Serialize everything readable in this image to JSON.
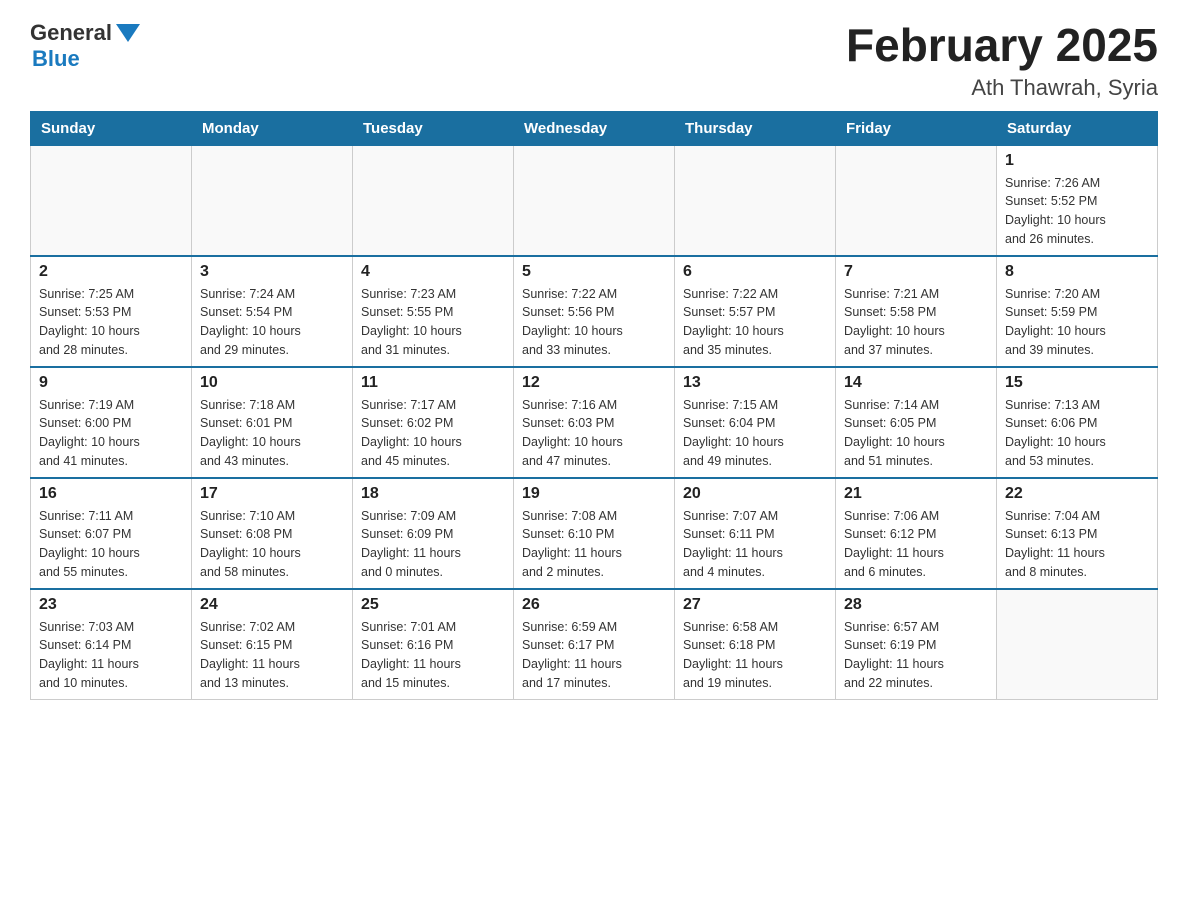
{
  "logo": {
    "general": "General",
    "blue": "Blue"
  },
  "title": "February 2025",
  "subtitle": "Ath Thawrah, Syria",
  "weekdays": [
    "Sunday",
    "Monday",
    "Tuesday",
    "Wednesday",
    "Thursday",
    "Friday",
    "Saturday"
  ],
  "weeks": [
    [
      {
        "day": "",
        "info": ""
      },
      {
        "day": "",
        "info": ""
      },
      {
        "day": "",
        "info": ""
      },
      {
        "day": "",
        "info": ""
      },
      {
        "day": "",
        "info": ""
      },
      {
        "day": "",
        "info": ""
      },
      {
        "day": "1",
        "info": "Sunrise: 7:26 AM\nSunset: 5:52 PM\nDaylight: 10 hours\nand 26 minutes."
      }
    ],
    [
      {
        "day": "2",
        "info": "Sunrise: 7:25 AM\nSunset: 5:53 PM\nDaylight: 10 hours\nand 28 minutes."
      },
      {
        "day": "3",
        "info": "Sunrise: 7:24 AM\nSunset: 5:54 PM\nDaylight: 10 hours\nand 29 minutes."
      },
      {
        "day": "4",
        "info": "Sunrise: 7:23 AM\nSunset: 5:55 PM\nDaylight: 10 hours\nand 31 minutes."
      },
      {
        "day": "5",
        "info": "Sunrise: 7:22 AM\nSunset: 5:56 PM\nDaylight: 10 hours\nand 33 minutes."
      },
      {
        "day": "6",
        "info": "Sunrise: 7:22 AM\nSunset: 5:57 PM\nDaylight: 10 hours\nand 35 minutes."
      },
      {
        "day": "7",
        "info": "Sunrise: 7:21 AM\nSunset: 5:58 PM\nDaylight: 10 hours\nand 37 minutes."
      },
      {
        "day": "8",
        "info": "Sunrise: 7:20 AM\nSunset: 5:59 PM\nDaylight: 10 hours\nand 39 minutes."
      }
    ],
    [
      {
        "day": "9",
        "info": "Sunrise: 7:19 AM\nSunset: 6:00 PM\nDaylight: 10 hours\nand 41 minutes."
      },
      {
        "day": "10",
        "info": "Sunrise: 7:18 AM\nSunset: 6:01 PM\nDaylight: 10 hours\nand 43 minutes."
      },
      {
        "day": "11",
        "info": "Sunrise: 7:17 AM\nSunset: 6:02 PM\nDaylight: 10 hours\nand 45 minutes."
      },
      {
        "day": "12",
        "info": "Sunrise: 7:16 AM\nSunset: 6:03 PM\nDaylight: 10 hours\nand 47 minutes."
      },
      {
        "day": "13",
        "info": "Sunrise: 7:15 AM\nSunset: 6:04 PM\nDaylight: 10 hours\nand 49 minutes."
      },
      {
        "day": "14",
        "info": "Sunrise: 7:14 AM\nSunset: 6:05 PM\nDaylight: 10 hours\nand 51 minutes."
      },
      {
        "day": "15",
        "info": "Sunrise: 7:13 AM\nSunset: 6:06 PM\nDaylight: 10 hours\nand 53 minutes."
      }
    ],
    [
      {
        "day": "16",
        "info": "Sunrise: 7:11 AM\nSunset: 6:07 PM\nDaylight: 10 hours\nand 55 minutes."
      },
      {
        "day": "17",
        "info": "Sunrise: 7:10 AM\nSunset: 6:08 PM\nDaylight: 10 hours\nand 58 minutes."
      },
      {
        "day": "18",
        "info": "Sunrise: 7:09 AM\nSunset: 6:09 PM\nDaylight: 11 hours\nand 0 minutes."
      },
      {
        "day": "19",
        "info": "Sunrise: 7:08 AM\nSunset: 6:10 PM\nDaylight: 11 hours\nand 2 minutes."
      },
      {
        "day": "20",
        "info": "Sunrise: 7:07 AM\nSunset: 6:11 PM\nDaylight: 11 hours\nand 4 minutes."
      },
      {
        "day": "21",
        "info": "Sunrise: 7:06 AM\nSunset: 6:12 PM\nDaylight: 11 hours\nand 6 minutes."
      },
      {
        "day": "22",
        "info": "Sunrise: 7:04 AM\nSunset: 6:13 PM\nDaylight: 11 hours\nand 8 minutes."
      }
    ],
    [
      {
        "day": "23",
        "info": "Sunrise: 7:03 AM\nSunset: 6:14 PM\nDaylight: 11 hours\nand 10 minutes."
      },
      {
        "day": "24",
        "info": "Sunrise: 7:02 AM\nSunset: 6:15 PM\nDaylight: 11 hours\nand 13 minutes."
      },
      {
        "day": "25",
        "info": "Sunrise: 7:01 AM\nSunset: 6:16 PM\nDaylight: 11 hours\nand 15 minutes."
      },
      {
        "day": "26",
        "info": "Sunrise: 6:59 AM\nSunset: 6:17 PM\nDaylight: 11 hours\nand 17 minutes."
      },
      {
        "day": "27",
        "info": "Sunrise: 6:58 AM\nSunset: 6:18 PM\nDaylight: 11 hours\nand 19 minutes."
      },
      {
        "day": "28",
        "info": "Sunrise: 6:57 AM\nSunset: 6:19 PM\nDaylight: 11 hours\nand 22 minutes."
      },
      {
        "day": "",
        "info": ""
      }
    ]
  ]
}
